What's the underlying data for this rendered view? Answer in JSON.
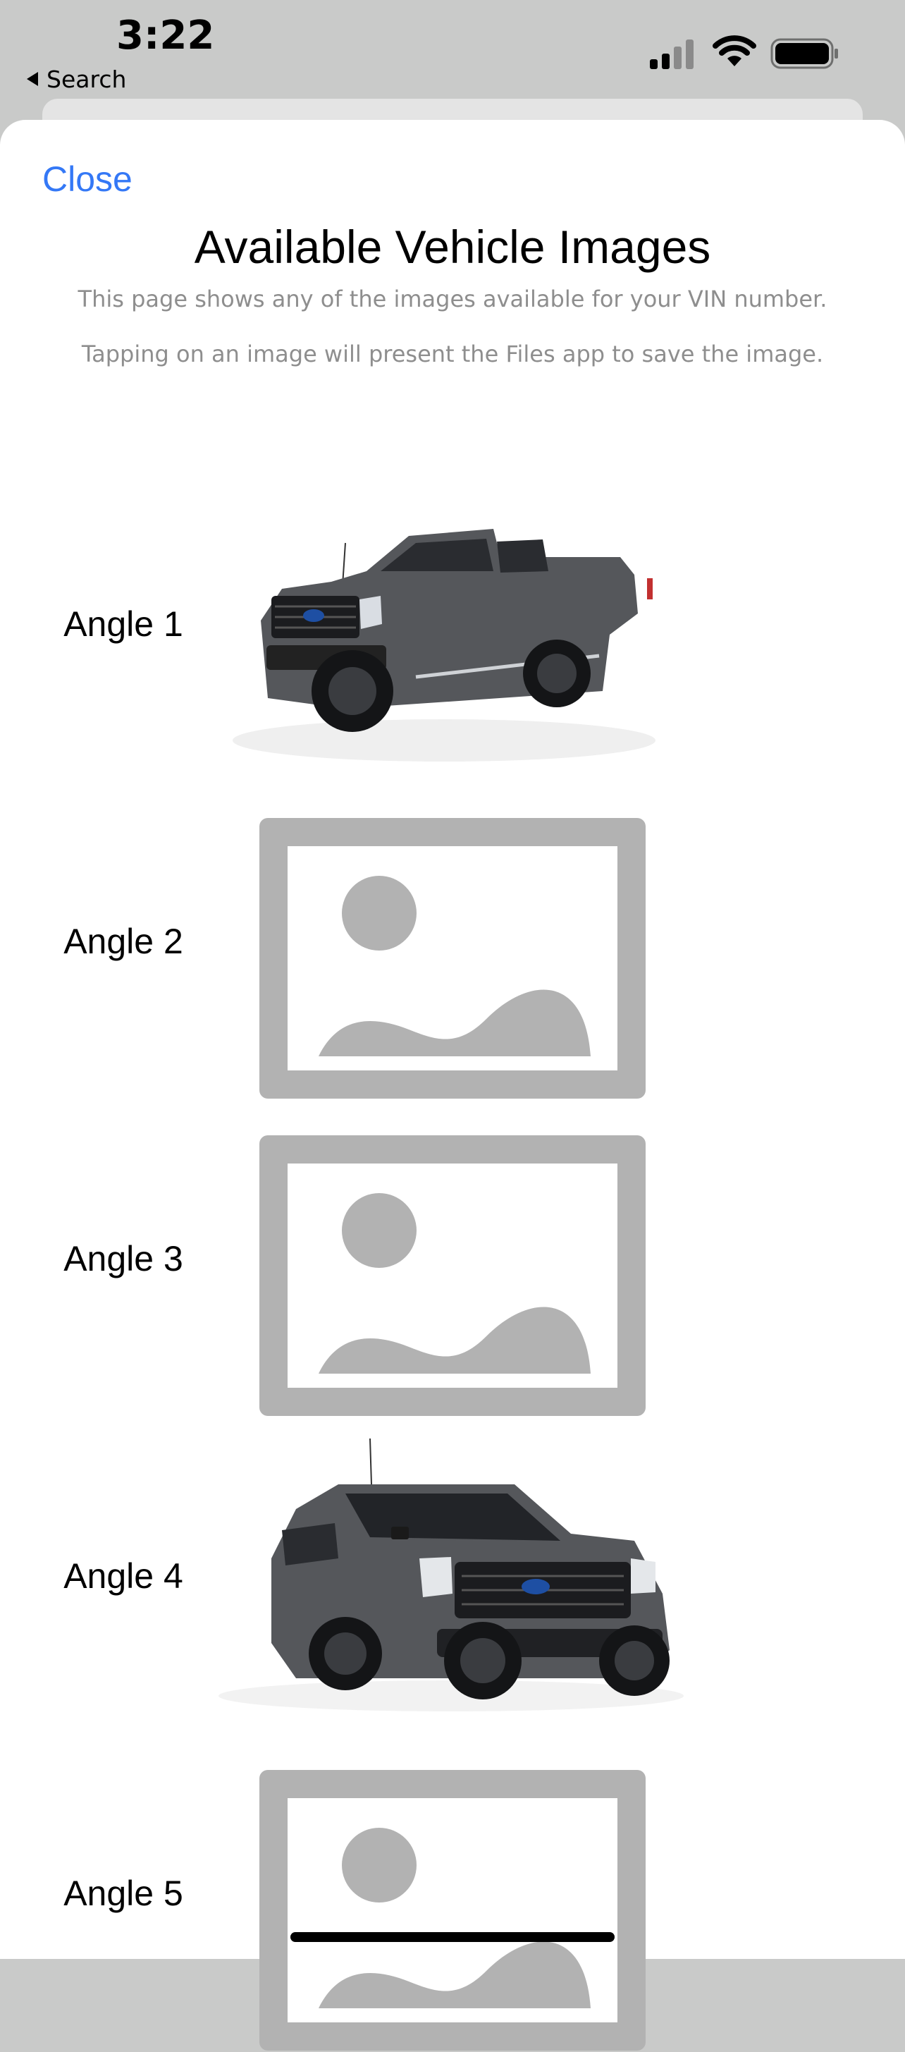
{
  "status_bar": {
    "time": "3:22",
    "back_app": "Search",
    "signal_bars": 4,
    "signal_active": 2
  },
  "sheet": {
    "close_label": "Close",
    "title": "Available Vehicle Images",
    "description": "This page shows any of the images available for your VIN number.",
    "instructions": "Tapping on an image will present the Files app to save the image."
  },
  "images": [
    {
      "label": "Angle 1",
      "type": "truck",
      "view": "side",
      "icon": "truck-photo"
    },
    {
      "label": "Angle 2",
      "type": "placeholder",
      "icon": "image-placeholder-icon"
    },
    {
      "label": "Angle 3",
      "type": "placeholder",
      "icon": "image-placeholder-icon"
    },
    {
      "label": "Angle 4",
      "type": "truck",
      "view": "front",
      "icon": "truck-photo"
    },
    {
      "label": "Angle 5",
      "type": "placeholder",
      "icon": "image-placeholder-icon"
    }
  ],
  "colors": {
    "accent": "#3478f6",
    "placeholder": "#b2b2b2",
    "truck_body": "#55575b",
    "subtitle": "#8e8e8e"
  }
}
